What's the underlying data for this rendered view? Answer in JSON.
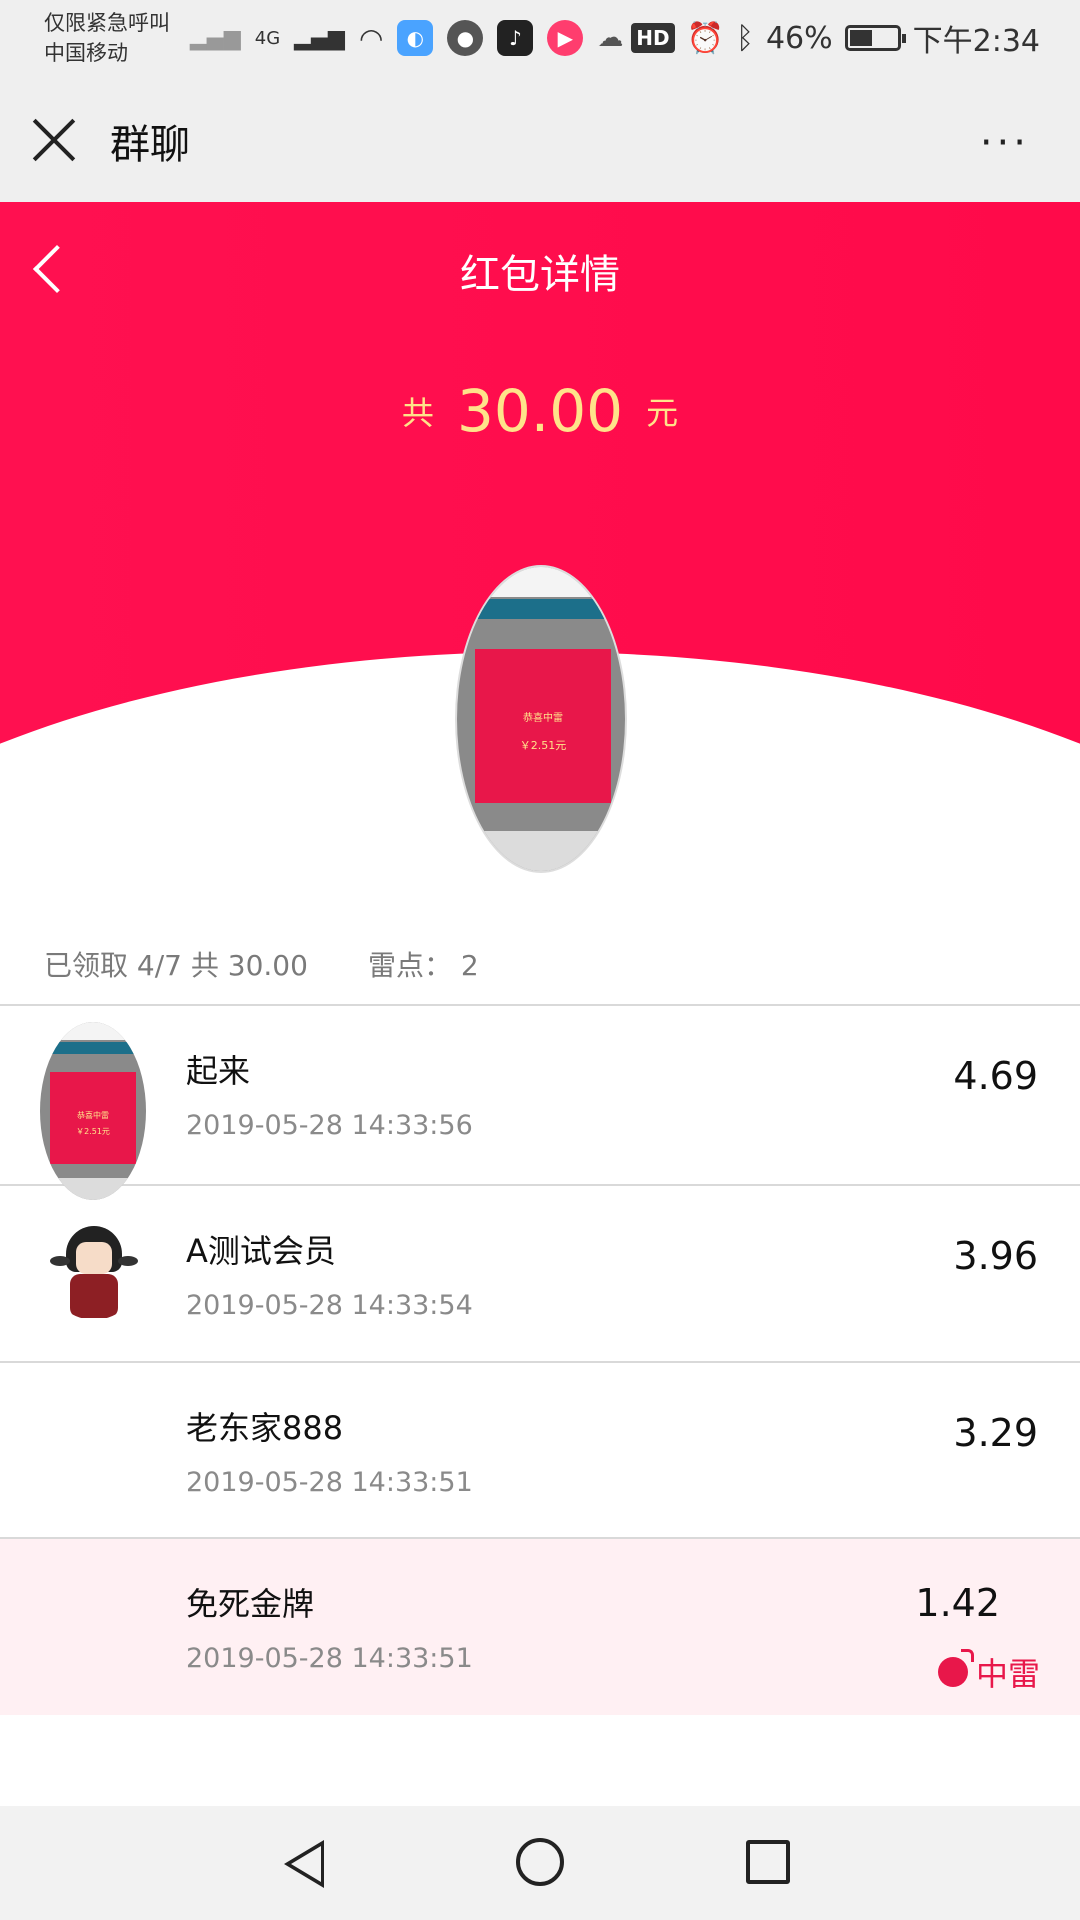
{
  "status_bar": {
    "carrier_line1": "仅限紧急呼叫",
    "carrier_line2": "中国移动",
    "network": "4G",
    "hd": "HD",
    "battery": "46%",
    "time": "下午2:34"
  },
  "header": {
    "title": "群聊",
    "more": "···"
  },
  "red_packet": {
    "title": "红包详情",
    "total_prefix": "共",
    "total_amount": "30.00",
    "total_suffix": "元",
    "avatar_text_1": "恭喜中雷",
    "avatar_text_2": "￥2.51元"
  },
  "summary": {
    "received": "已领取 4/7 共 30.00",
    "mine_point": "雷点： 2"
  },
  "records": [
    {
      "name": "起来",
      "time": "2019-05-28   14:33:56",
      "amount": "4.69"
    },
    {
      "name": "A测试会员",
      "time": "2019-05-28   14:33:54",
      "amount": "3.96"
    },
    {
      "name": "老东家888",
      "time": "2019-05-28   14:33:51",
      "amount": "3.29"
    },
    {
      "name": "免死金牌",
      "time": "2019-05-28   14:33:51",
      "amount": "1.42",
      "tag": "中雷"
    }
  ],
  "colors": {
    "header_red": "#ff1050",
    "gold": "#ffe38a",
    "mine_bg": "#fff0f3",
    "mine_text": "#e8174a"
  }
}
